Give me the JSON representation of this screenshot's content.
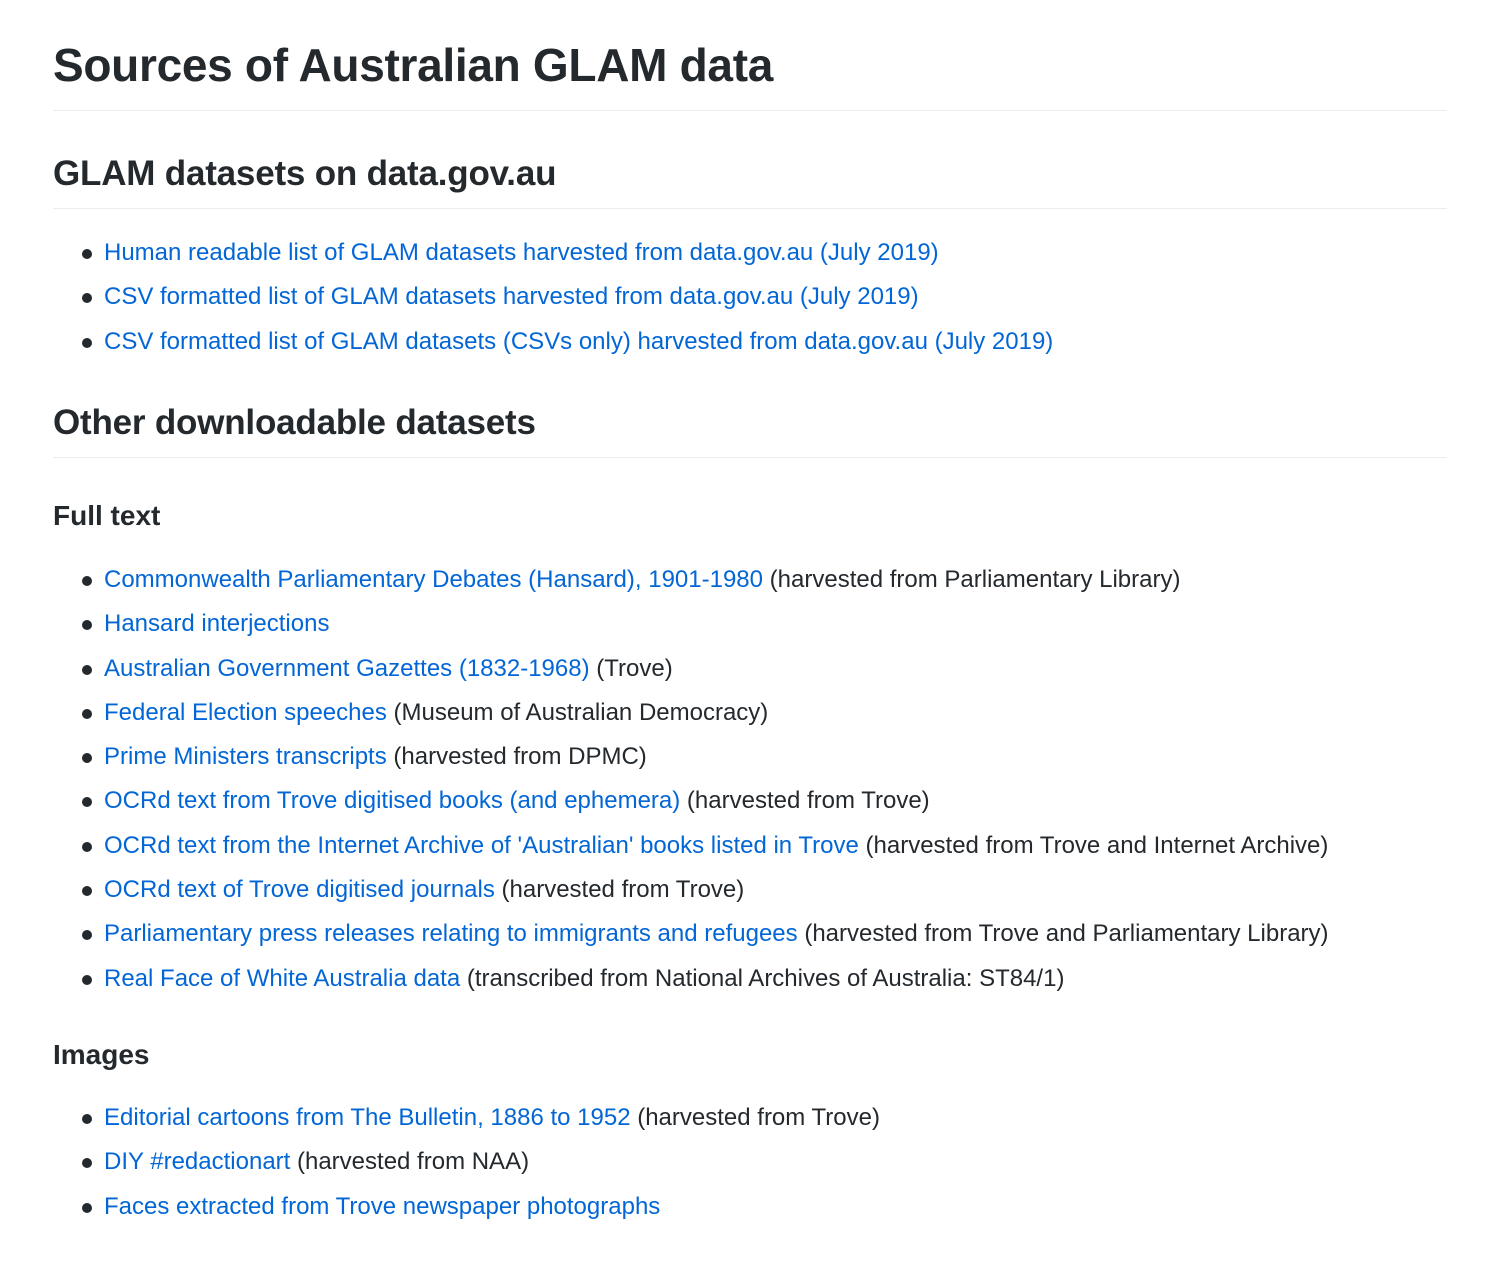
{
  "title": "Sources of Australian GLAM data",
  "sections": {
    "datagov": {
      "heading": "GLAM datasets on data.gov.au",
      "items": [
        {
          "link": "Human readable list of GLAM datasets harvested from data.gov.au (July 2019)",
          "note": ""
        },
        {
          "link": "CSV formatted list of GLAM datasets harvested from data.gov.au (July 2019)",
          "note": ""
        },
        {
          "link": "CSV formatted list of GLAM datasets (CSVs only) harvested from data.gov.au (July 2019)",
          "note": ""
        }
      ]
    },
    "other": {
      "heading": "Other downloadable datasets",
      "fulltext": {
        "heading": "Full text",
        "items": [
          {
            "link": "Commonwealth Parliamentary Debates (Hansard), 1901-1980",
            "note": " (harvested from Parliamentary Library)"
          },
          {
            "link": "Hansard interjections",
            "note": ""
          },
          {
            "link": "Australian Government Gazettes (1832-1968)",
            "note": " (Trove)"
          },
          {
            "link": "Federal Election speeches",
            "note": " (Museum of Australian Democracy)"
          },
          {
            "link": "Prime Ministers transcripts",
            "note": " (harvested from DPMC)"
          },
          {
            "link": "OCRd text from Trove digitised books (and ephemera)",
            "note": " (harvested from Trove)"
          },
          {
            "link": "OCRd text from the Internet Archive of 'Australian' books listed in Trove",
            "note": " (harvested from Trove and Internet Archive)"
          },
          {
            "link": "OCRd text of Trove digitised journals",
            "note": " (harvested from Trove)"
          },
          {
            "link": "Parliamentary press releases relating to immigrants and refugees",
            "note": " (harvested from Trove and Parliamentary Library)"
          },
          {
            "link": "Real Face of White Australia data",
            "note": " (transcribed from National Archives of Australia: ST84/1)"
          }
        ]
      },
      "images": {
        "heading": "Images",
        "items": [
          {
            "link": "Editorial cartoons from The Bulletin, 1886 to 1952",
            "note": " (harvested from Trove)"
          },
          {
            "link": "DIY #redactionart",
            "note": " (harvested from NAA)"
          },
          {
            "link": "Faces extracted from Trove newspaper photographs",
            "note": ""
          }
        ]
      }
    }
  },
  "colors": {
    "text": "#24292e",
    "link": "#0366d6",
    "rule": "#eaecef"
  }
}
